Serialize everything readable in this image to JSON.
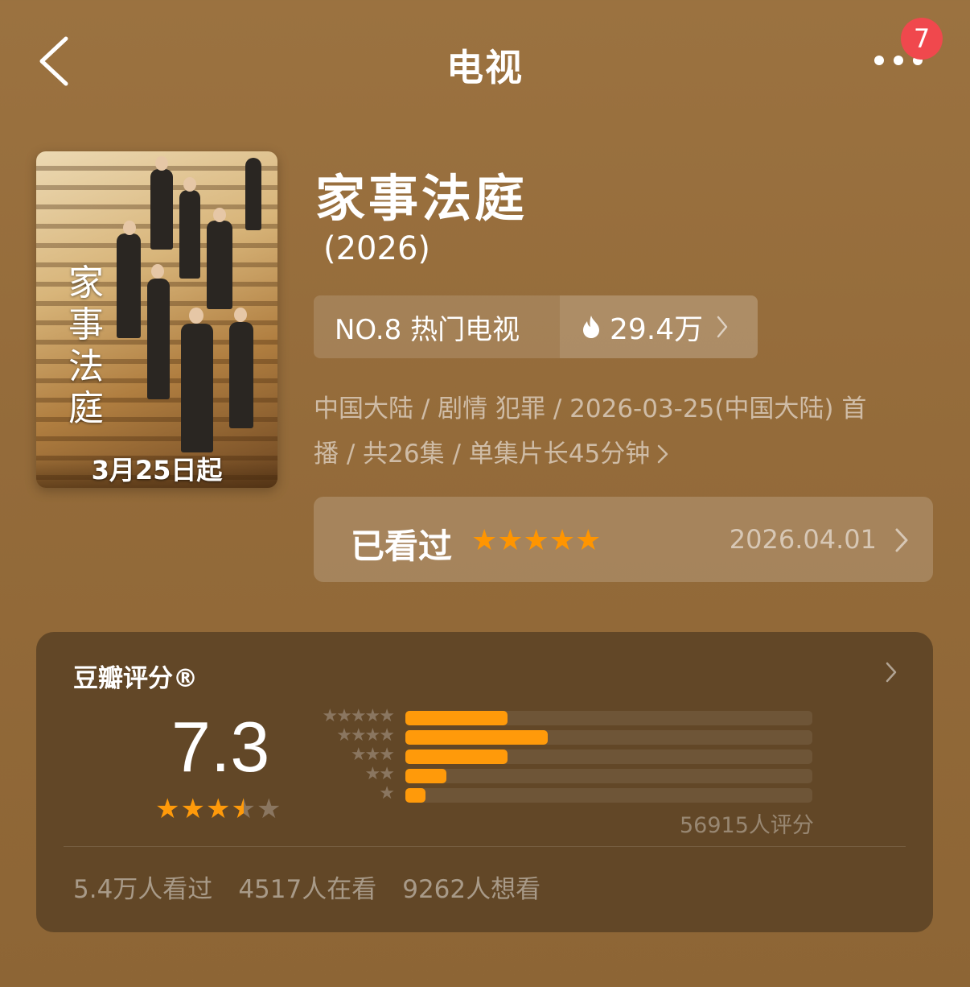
{
  "nav": {
    "title": "电视",
    "badge": "7"
  },
  "poster": {
    "title": "家事法庭",
    "date_text": "3月25日起"
  },
  "show": {
    "title": "家事法庭",
    "year": "(2026)",
    "rank_label": "NO.8 热门电视",
    "heat": "29.4万",
    "meta_line1": "中国大陆 / 剧情 犯罪 / 2026-03-25(中国大陆) 首",
    "meta_line2": "播 / 共26集 / 单集片长45分钟"
  },
  "watched": {
    "label": "已看过",
    "stars": "★★★★★",
    "date": "2026.04.01",
    "rating_stars": 5
  },
  "rating": {
    "title": "豆瓣评分®",
    "score": "7.3",
    "stars_value": 3.5,
    "distribution": [
      {
        "stars": "★★★★★",
        "percent": 25
      },
      {
        "stars": "★★★★",
        "percent": 35
      },
      {
        "stars": "★★★",
        "percent": 25
      },
      {
        "stars": "★★",
        "percent": 10
      },
      {
        "stars": "★",
        "percent": 5
      }
    ],
    "count_text": "56915人评分",
    "stats": {
      "watched": "5.4万人看过",
      "watching": "4517人在看",
      "want": "9262人想看"
    }
  },
  "colors": {
    "accent": "#ff9a0a",
    "badge": "#f0484d",
    "background": "#946b3a",
    "card": "#624727"
  }
}
